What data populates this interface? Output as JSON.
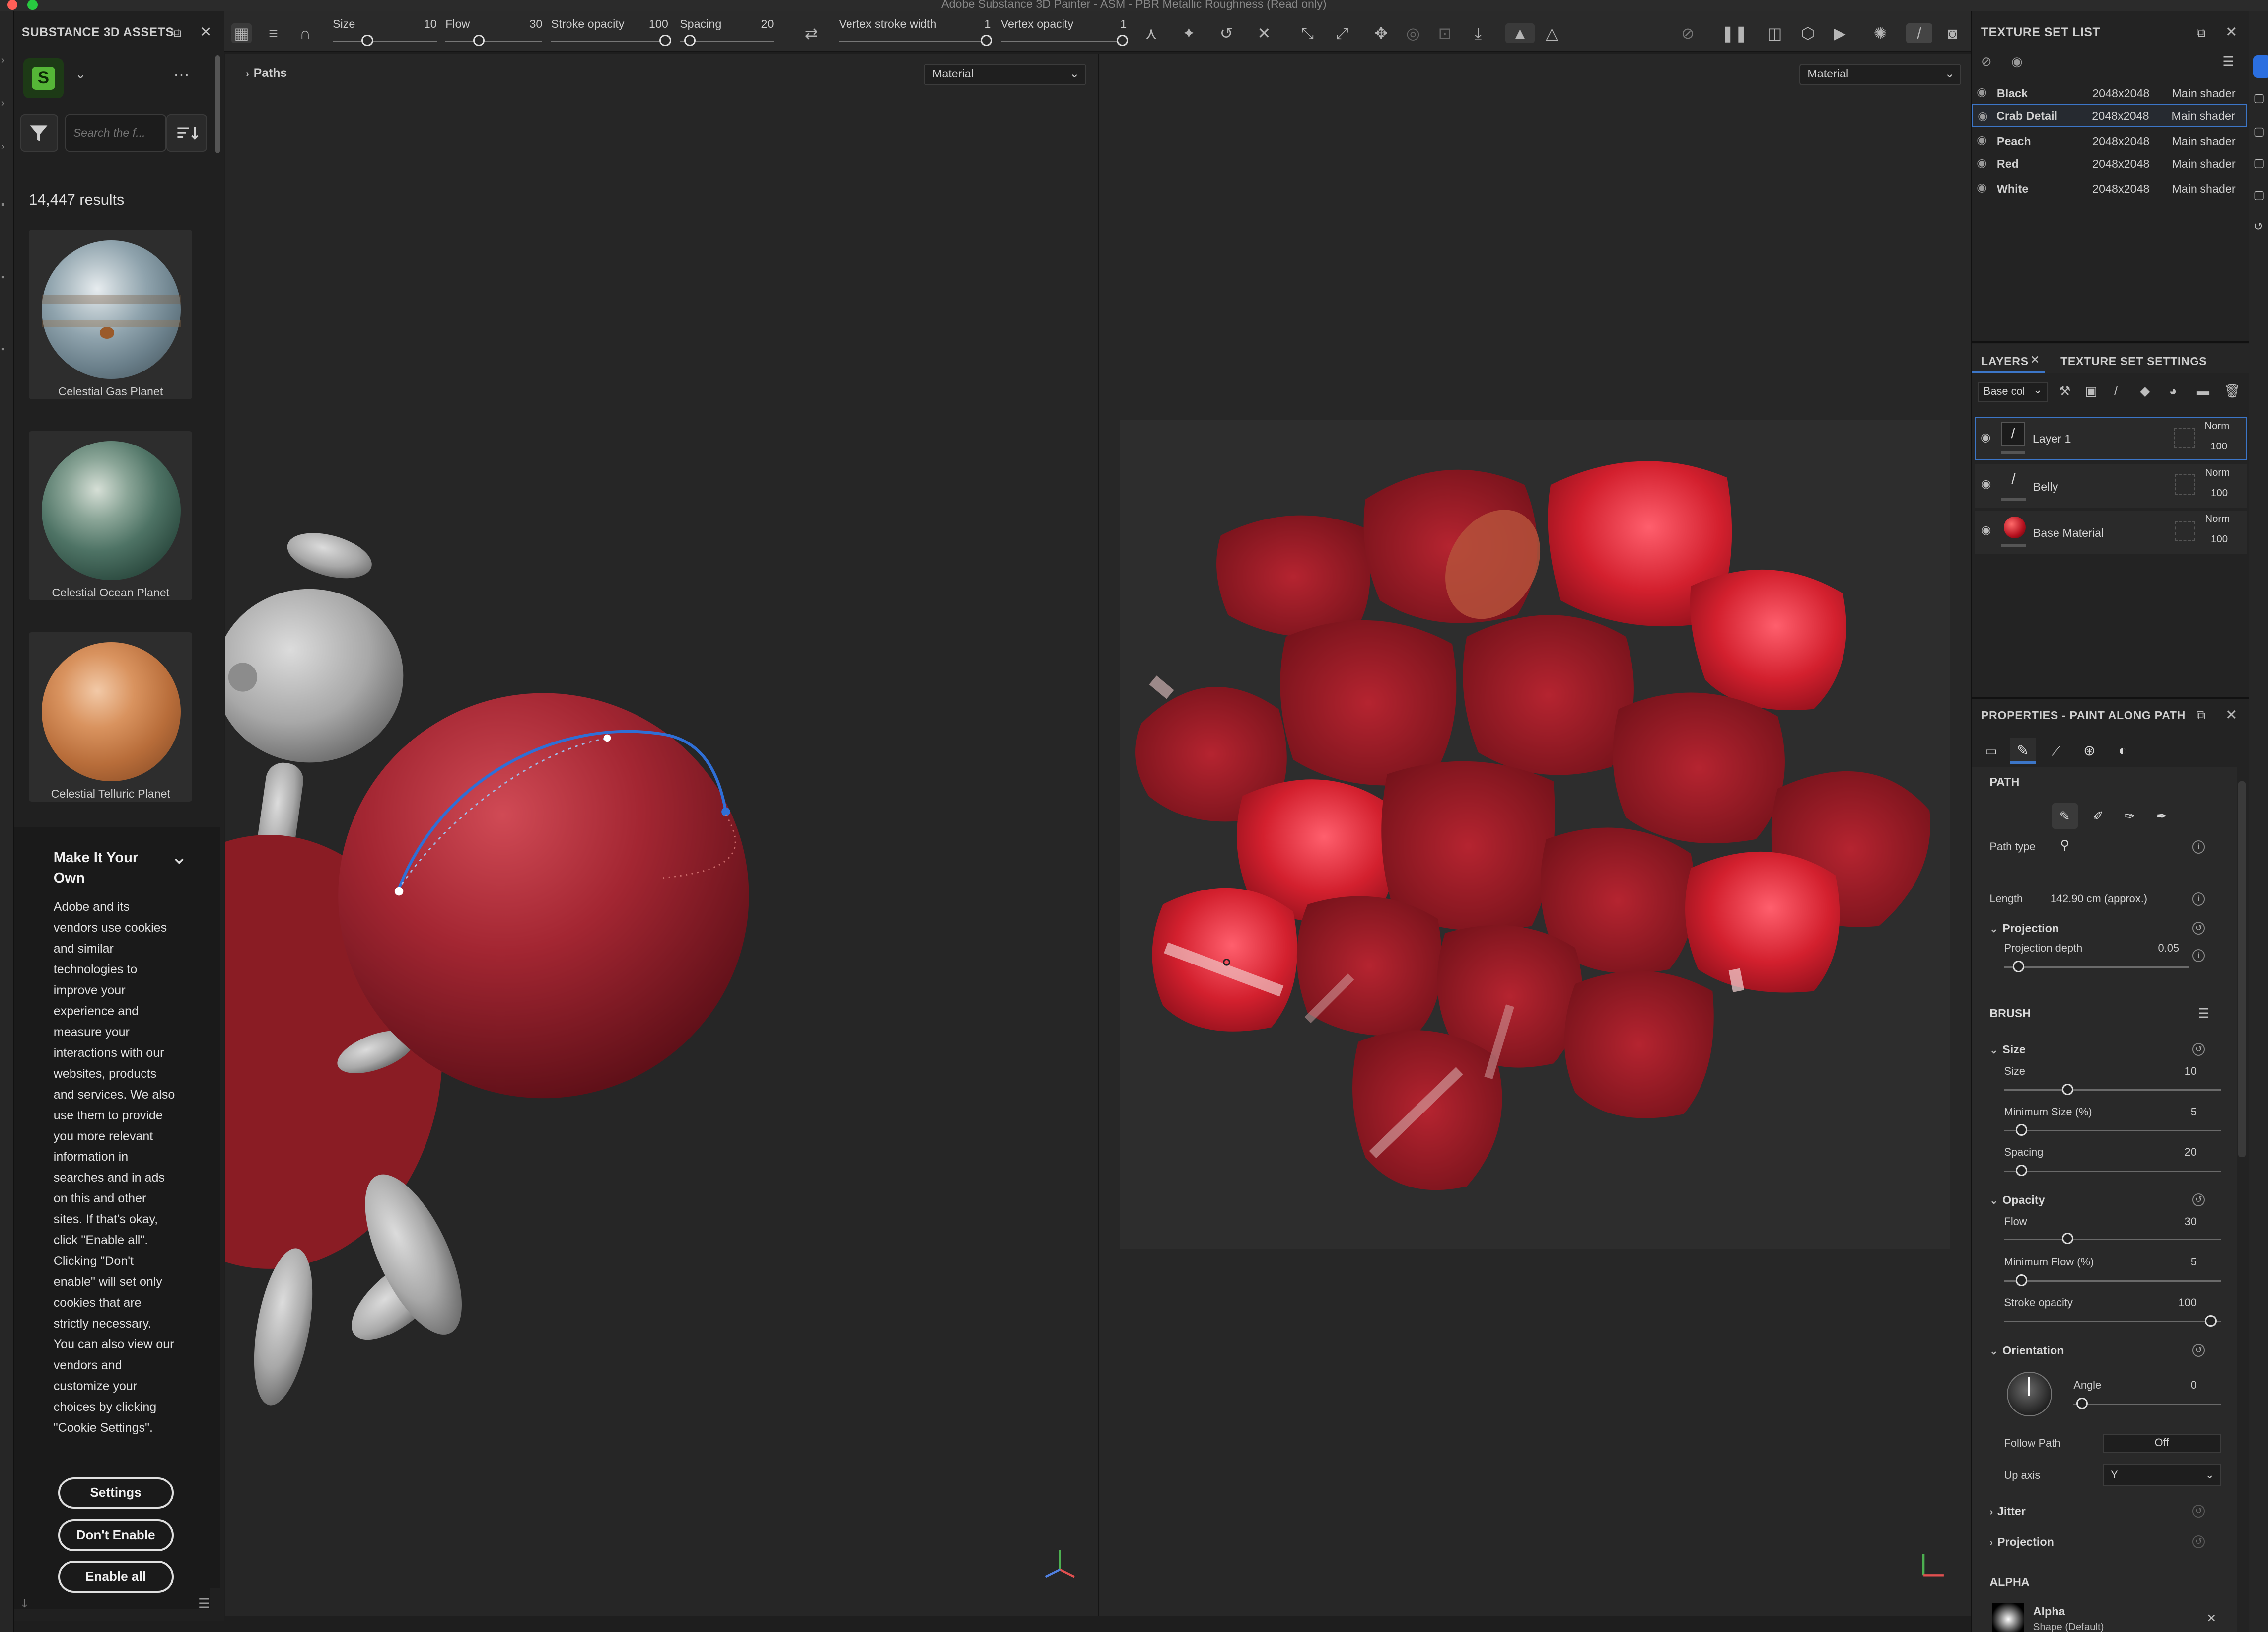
{
  "window_title": "Adobe Substance 3D Painter - ASM - PBR Metallic Roughness (Read only)",
  "assets_panel": {
    "title": "SUBSTANCE 3D ASSETS",
    "search_placeholder": "Search the f...",
    "results": "14,447 results",
    "items": [
      {
        "name": "Celestial Gas Planet"
      },
      {
        "name": "Celestial Ocean Planet"
      },
      {
        "name": "Celestial Telluric Planet"
      }
    ],
    "cookie": {
      "title": "Make It Your Own",
      "body": "Adobe and its vendors use cookies and similar technologies to improve your experience and measure your interactions with our websites, products and services. We also use them to provide you more relevant information in searches and in ads on this and other sites. If that's okay, click \"Enable all\". Clicking \"Don't enable\" will set only cookies that are strictly necessary. You can also view our vendors and customize your choices by clicking \"Cookie Settings\".",
      "settings_label": "Settings",
      "dont_enable_label": "Don't Enable",
      "enable_all_label": "Enable all"
    }
  },
  "toolbar": {
    "size_label": "Size",
    "size_value": "10",
    "flow_label": "Flow",
    "flow_value": "30",
    "stroke_opacity_label": "Stroke opacity",
    "stroke_opacity_value": "100",
    "spacing_label": "Spacing",
    "spacing_value": "20",
    "vertex_stroke_width_label": "Vertex stroke width",
    "vertex_stroke_width_value": "1",
    "vertex_opacity_label": "Vertex opacity",
    "vertex_opacity_value": "1"
  },
  "viewport_3d": {
    "breadcrumb": "Paths",
    "channel": "Material"
  },
  "viewport_2d": {
    "channel": "Material"
  },
  "texture_set_list": {
    "title": "TEXTURE SET LIST",
    "sets": [
      {
        "name": "Black",
        "resolution": "2048x2048",
        "shader": "Main shader"
      },
      {
        "name": "Crab Detail",
        "resolution": "2048x2048",
        "shader": "Main shader"
      },
      {
        "name": "Peach",
        "resolution": "2048x2048",
        "shader": "Main shader"
      },
      {
        "name": "Red",
        "resolution": "2048x2048",
        "shader": "Main shader"
      },
      {
        "name": "White",
        "resolution": "2048x2048",
        "shader": "Main shader"
      }
    ]
  },
  "layers_panel": {
    "tab_layers": "LAYERS",
    "tab_texture_set_settings": "TEXTURE SET SETTINGS",
    "channel": "Base col",
    "layers": [
      {
        "name": "Layer 1",
        "blend": "Norm",
        "opacity": "100"
      },
      {
        "name": "Belly",
        "blend": "Norm",
        "opacity": "100"
      },
      {
        "name": "Base Material",
        "blend": "Norm",
        "opacity": "100"
      }
    ]
  },
  "properties": {
    "title": "PROPERTIES - PAINT ALONG PATH",
    "path_section": "PATH",
    "path_type_label": "Path type",
    "length_label": "Length",
    "length_value": "142.90 cm (approx.)",
    "projection_label": "Projection",
    "projection_depth_label": "Projection depth",
    "projection_depth_value": "0.05",
    "brush_section": "BRUSH",
    "size_group": "Size",
    "size_label": "Size",
    "size_value": "10",
    "min_size_label": "Minimum Size (%)",
    "min_size_value": "5",
    "spacing_label": "Spacing",
    "spacing_value": "20",
    "opacity_group": "Opacity",
    "flow_label": "Flow",
    "flow_value": "30",
    "min_flow_label": "Minimum Flow (%)",
    "min_flow_value": "5",
    "stroke_opacity_label": "Stroke opacity",
    "stroke_opacity_value": "100",
    "orientation_group": "Orientation",
    "angle_label": "Angle",
    "angle_value": "0",
    "follow_path_label": "Follow Path",
    "follow_path_value": "Off",
    "up_axis_label": "Up axis",
    "up_axis_value": "Y",
    "jitter_group": "Jitter",
    "projection_group": "Projection",
    "alpha_section": "ALPHA",
    "alpha_name": "Alpha",
    "alpha_shape": "Shape (Default)"
  }
}
